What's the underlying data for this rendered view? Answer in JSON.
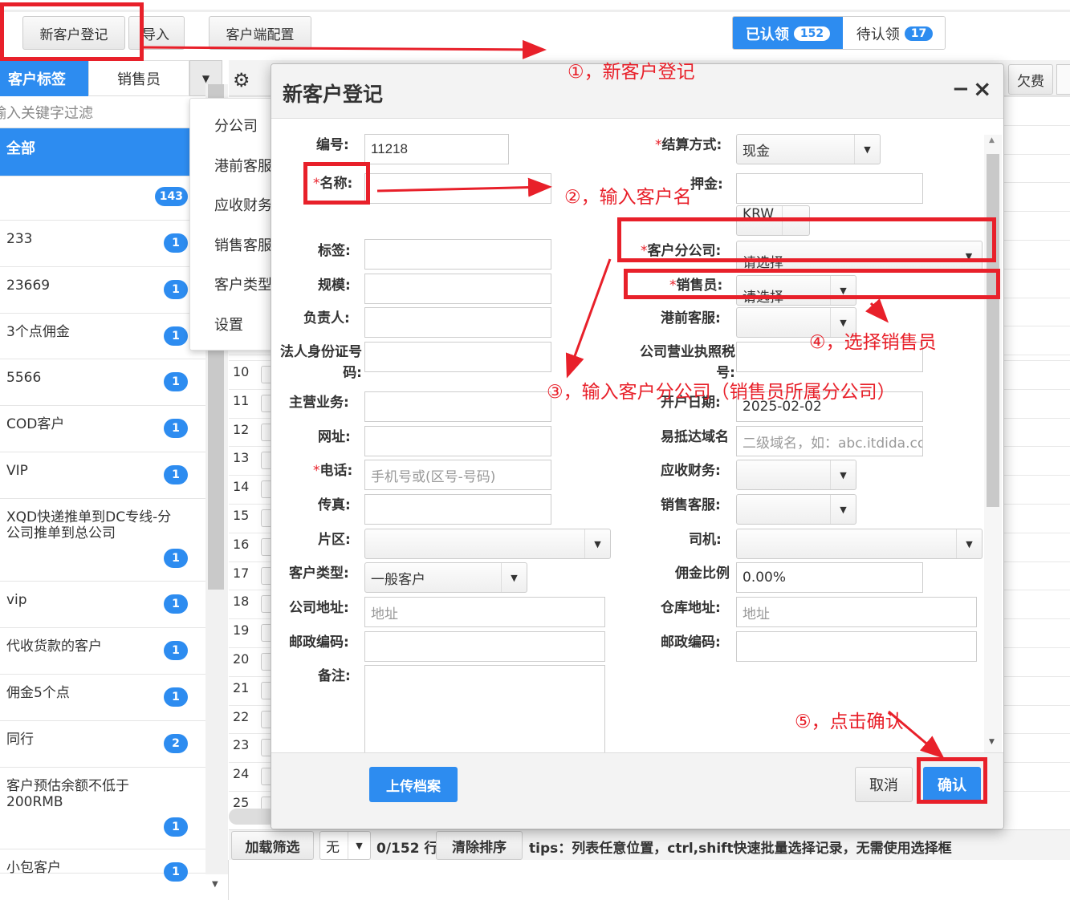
{
  "toolbar": {
    "new_customer": "新客户登记",
    "import": "导入",
    "client_config": "客户端配置",
    "claimed_label": "已认领",
    "claimed_count": "152",
    "unclaimed_label": "待认领",
    "unclaimed_count": "17"
  },
  "left": {
    "tab_tags": "客户标签",
    "tab_sales": "销售员",
    "filter_placeholder": "输入关键字过滤",
    "tags": [
      {
        "name": "全部",
        "count": ""
      },
      {
        "name": "",
        "count": "143"
      },
      {
        "name": "233",
        "count": "1"
      },
      {
        "name": "23669",
        "count": "1"
      },
      {
        "name": "3个点佣金",
        "count": "1"
      },
      {
        "name": "5566",
        "count": "1"
      },
      {
        "name": "COD客户",
        "count": "1"
      },
      {
        "name": "VIP",
        "count": "1"
      },
      {
        "name": "XQD快递推单到DC专线-分公司推单到总公司",
        "count": "1"
      },
      {
        "name": "vip",
        "count": "1"
      },
      {
        "name": "代收货款的客户",
        "count": "1"
      },
      {
        "name": "佣金5个点",
        "count": "1"
      },
      {
        "name": "同行",
        "count": "2"
      },
      {
        "name": "客户预估余额不低于200RMB",
        "count": "1"
      },
      {
        "name": "小包客户",
        "count": "1"
      }
    ]
  },
  "menu": {
    "items": [
      "分公司",
      "港前客服",
      "应收财务",
      "销售客服",
      "客户类型",
      "设置"
    ]
  },
  "grid": {
    "rows": [
      "10",
      "11",
      "12",
      "13",
      "14",
      "15",
      "16",
      "17",
      "18",
      "19",
      "20",
      "21",
      "22",
      "23",
      "24",
      "25"
    ],
    "col_arrears": "欠费"
  },
  "modal": {
    "title": "新客户登记",
    "fields": {
      "code_label": "编号:",
      "code_value": "11218",
      "name_label": "名称:",
      "tag_label": "标签:",
      "scale_label": "规模:",
      "owner_label": "负责人:",
      "legal_id_label": "法人身份证号码:",
      "business_label": "主营业务:",
      "website_label": "网址:",
      "phone_label": "电话:",
      "phone_placeholder": "手机号或(区号-号码)",
      "fax_label": "传真:",
      "area_label": "片区:",
      "ctype_label": "客户类型:",
      "ctype_value": "一般客户",
      "addr_label": "公司地址:",
      "addr_placeholder": "地址",
      "zip_label": "邮政编码:",
      "remark_label": "备注:",
      "settle_label": "结算方式:",
      "settle_value": "现金",
      "deposit_label": "押金:",
      "currency_value": "KRW",
      "branch_label": "客户分公司:",
      "branch_value": "请选择",
      "sales_label": "销售员:",
      "sales_value": "请选择",
      "port_cs_label": "港前客服:",
      "license_label": "公司营业执照税号:",
      "open_date_label": "开户日期:",
      "open_date_value": "2025-02-02",
      "domain_label": "易抵达域名",
      "domain_placeholder": "二级域名，如：abc.itdida.com",
      "ar_label": "应收财务:",
      "sales_cs_label": "销售客服:",
      "driver_label": "司机:",
      "commission_label": "佣金比例",
      "commission_value": "0.00%",
      "wh_addr_label": "仓库地址:",
      "wh_addr_placeholder": "地址",
      "wh_zip_label": "邮政编码:"
    },
    "upload": "上传档案",
    "cancel": "取消",
    "confirm": "确认",
    "min_glyph": "−",
    "close_glyph": "×"
  },
  "bottom": {
    "load_filter": "加载筛选",
    "none": "无",
    "rows_count": "0/152 行",
    "clear_sort": "清除排序",
    "tips": "tips：列表任意位置，ctrl,shift快速批量选择记录，无需使用选择框"
  },
  "annotations": {
    "step1": "①，新客户登记",
    "step2": "②，输入客户名",
    "step3": "③，输入客户分公司（销售员所属分公司）",
    "step4": "④，选择销售员",
    "step5": "⑤，点击确认"
  },
  "colors": {
    "accent": "#2d8cf0",
    "annotation": "#e8202a"
  }
}
